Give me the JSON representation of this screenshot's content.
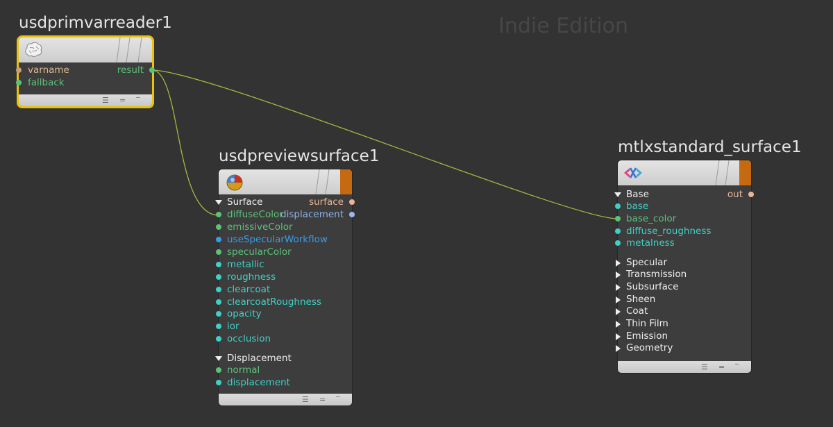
{
  "watermark": "Indie Edition",
  "node_primvar": {
    "title": "usdprimvarreader1",
    "inputs": [
      "varname",
      "fallback"
    ],
    "output": "result"
  },
  "node_preview": {
    "title": "usdpreviewsurface1",
    "surface_section": "Surface",
    "outputs": [
      "surface",
      "displacement"
    ],
    "surface_inputs": [
      "diffuseColor",
      "emissiveColor",
      "useSpecularWorkflow",
      "specularColor",
      "metallic",
      "roughness",
      "clearcoat",
      "clearcoatRoughness",
      "opacity",
      "ior",
      "occlusion"
    ],
    "displacement_section": "Displacement",
    "displacement_inputs": [
      "normal",
      "displacement"
    ]
  },
  "node_mtlx": {
    "title": "mtlxstandard_surface1",
    "base_section": "Base",
    "output": "out",
    "base_inputs": [
      "base",
      "base_color",
      "diffuse_roughness",
      "metalness"
    ],
    "collapsed_sections": [
      "Specular",
      "Transmission",
      "Subsurface",
      "Sheen",
      "Coat",
      "Thin Film",
      "Emission",
      "Geometry"
    ]
  },
  "footer_glyphs": [
    "☰",
    "=",
    "‾"
  ],
  "colors": {
    "background": "#333333",
    "selection": "#e8c20c",
    "wire": "#9cbd3e",
    "orange_flag": "#c66a11"
  }
}
